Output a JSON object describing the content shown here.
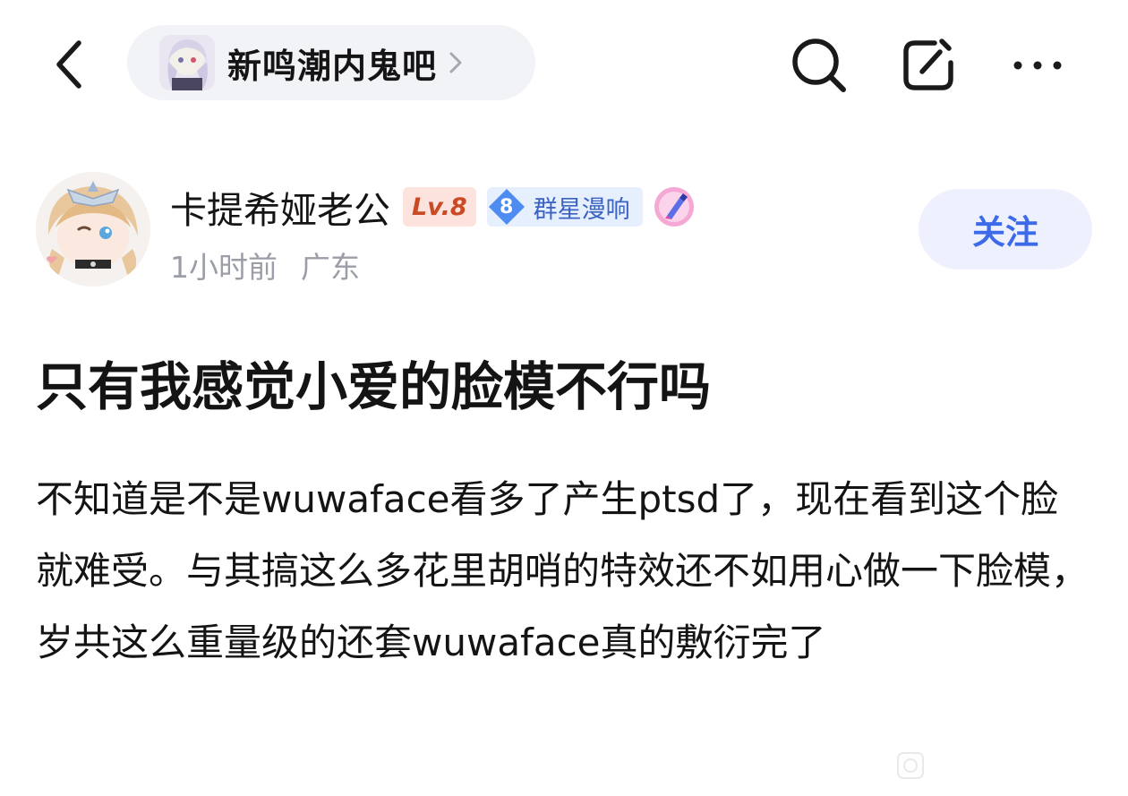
{
  "topbar": {
    "forum_name": "新鸣潮内鬼吧",
    "icons": [
      "back-arrow-icon",
      "forum-avatar",
      "chevron-right-icon",
      "search-icon",
      "share-icon",
      "more-icon"
    ]
  },
  "author": {
    "name": "卡提希娅老公",
    "level": "Lv.8",
    "group_level": "8",
    "group_name": "群星漫响",
    "time": "1小时前",
    "location": "广东",
    "follow_label": "关注"
  },
  "post": {
    "title": "只有我感觉小爱的脸模不行吗",
    "body": "不知道是不是wuwaface看多了产生ptsd了，现在看到这个脸就难受。与其搞这么多花里胡哨的特效还不如用心做一下脸模，岁共这么重量级的还套wuwaface真的敷衍完了"
  },
  "colors": {
    "accent": "#3d6ae8",
    "follow_bg": "#eef1fd",
    "pill_bg": "#f2f3f7",
    "meta_text": "#9b9ea6",
    "level_bg": "#fde3de",
    "level_text": "#c94a24",
    "group_bg": "#e6effe",
    "group_text": "#3b63c4"
  }
}
